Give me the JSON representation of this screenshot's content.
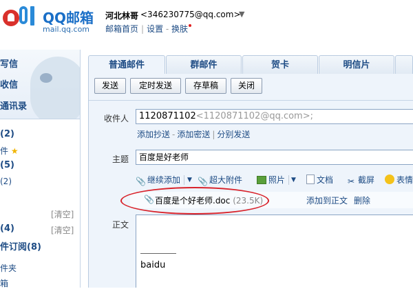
{
  "header": {
    "logo_text": "QQ邮箱",
    "logo_sub": "mail.qq.com",
    "user_name": "河北林哥",
    "user_email": "<346230775@qq.com>",
    "user_caret": "▼",
    "links": {
      "home": "邮箱首页",
      "settings": "设置",
      "skin": "换肤"
    }
  },
  "sidebar": {
    "main": [
      "写信",
      "收信",
      "通讯录"
    ],
    "items": [
      {
        "label": "(2)"
      },
      {
        "label": "件"
      },
      {
        "label": "(5)"
      },
      {
        "label": "(2)"
      },
      {
        "label": "",
        "action": "[清空]"
      },
      {
        "label": "(4)",
        "action": "[清空]"
      },
      {
        "label": "件订阅(8)"
      },
      {
        "label": "件夹"
      },
      {
        "label": "箱"
      }
    ]
  },
  "tabs": [
    "普通邮件",
    "群邮件",
    "贺卡",
    "明信片"
  ],
  "toolbar": {
    "send": "发送",
    "timed_send": "定时发送",
    "save_draft": "存草稿",
    "close": "关闭"
  },
  "compose": {
    "to_label": "收件人",
    "to_value": "1120871102",
    "to_value_grey": "<1120871102@qq.com>;",
    "cc_link": "添加抄送",
    "bcc_link": "添加密送",
    "separate_link": "分别发送",
    "subject_label": "主题",
    "subject_value": "百度是好老师",
    "body_label": "正文",
    "tools": {
      "continue_add": "继续添加",
      "big_attachment": "超大附件",
      "photo": "照片",
      "document": "文档",
      "screenshot": "截屏",
      "emoticon": "表情"
    },
    "attachment": {
      "name": "百度是个好老师.doc",
      "size": "(23.5K)",
      "add_to_body": "添加到正文",
      "delete": "删除"
    },
    "signature": "baidu"
  },
  "colors": {
    "link": "#1d4b84",
    "panel": "#eef4fb",
    "border": "#b9cbe0",
    "highlight_ellipse": "#d8222a"
  }
}
